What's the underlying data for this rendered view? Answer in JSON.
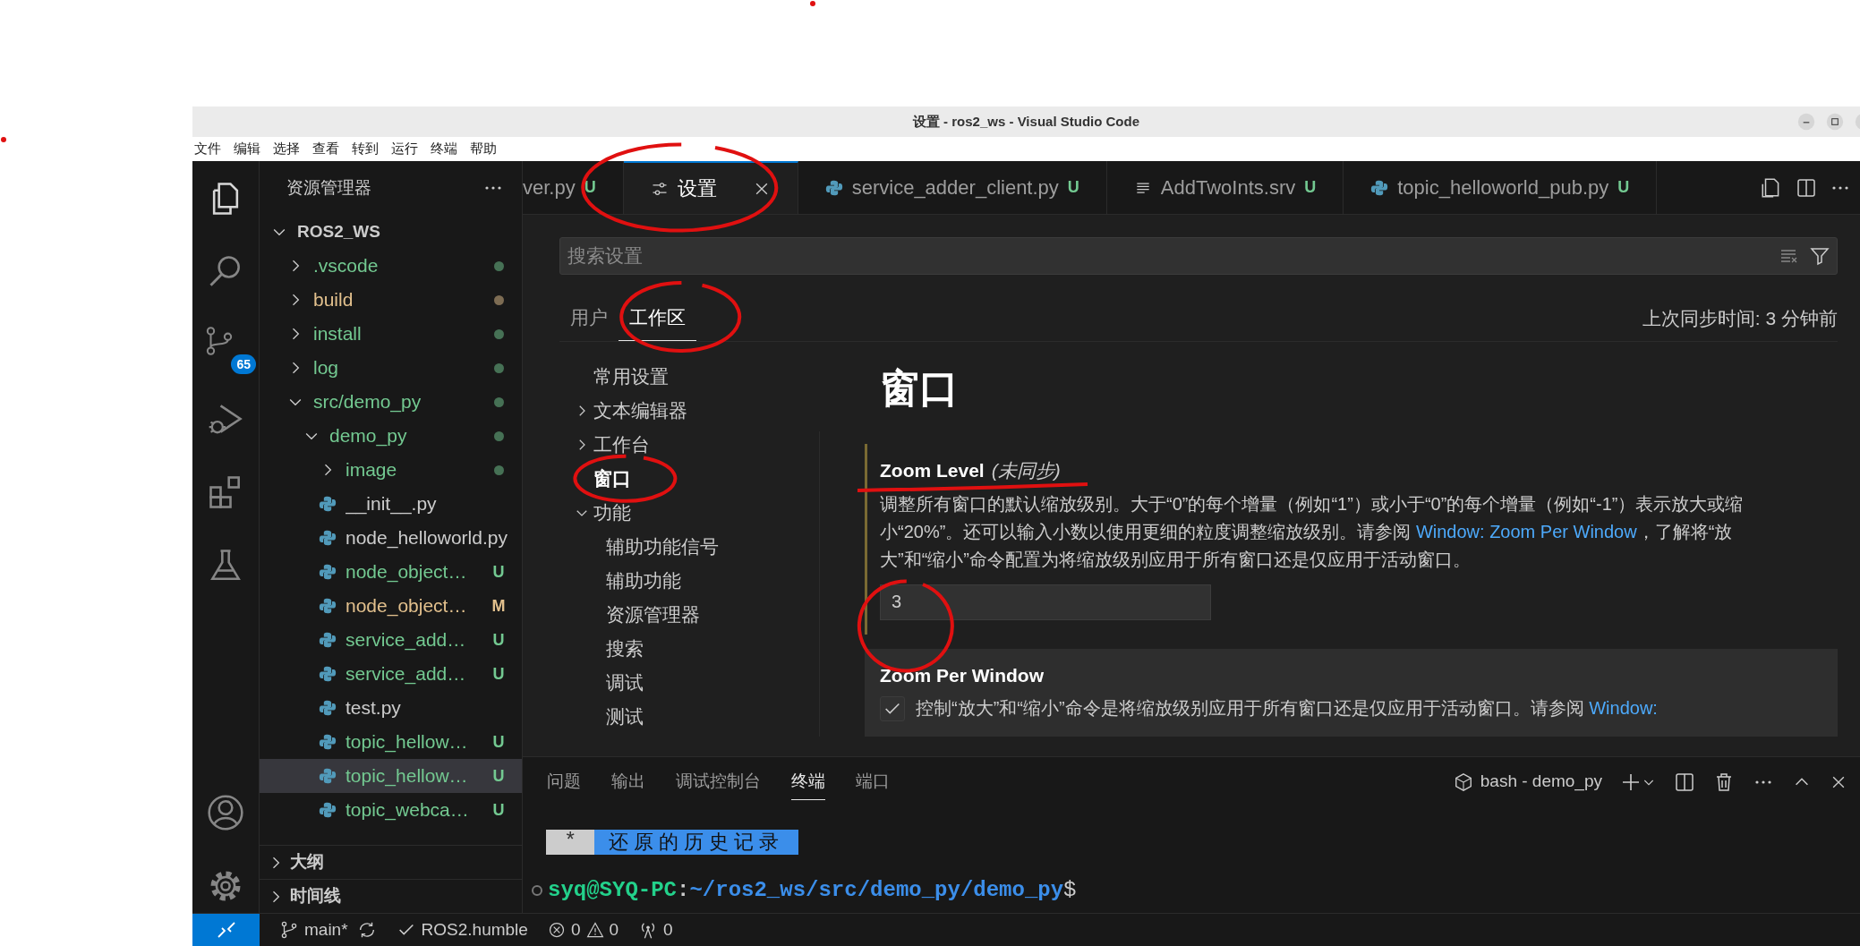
{
  "window": {
    "title": "设置 - ros2_ws - Visual Studio Code"
  },
  "menu": [
    "文件",
    "编辑",
    "选择",
    "查看",
    "转到",
    "运行",
    "终端",
    "帮助"
  ],
  "activity_bar": [
    {
      "kind": "explorer",
      "selected": true
    },
    {
      "kind": "search",
      "selected": false
    },
    {
      "kind": "source-control",
      "selected": false,
      "badge": "65"
    },
    {
      "kind": "run-debug",
      "selected": false
    },
    {
      "kind": "extensions",
      "selected": false
    },
    {
      "kind": "testing",
      "selected": false
    },
    {
      "kind": "account",
      "selected": false
    },
    {
      "kind": "manage",
      "selected": false
    }
  ],
  "sidebar": {
    "title": "资源管理器",
    "tree": {
      "label": "ROS2_WS",
      "kind": "root",
      "expanded": true,
      "selected": false,
      "children": [
        {
          "label": ".vscode",
          "kind": "folder",
          "expanded": false,
          "selected": false,
          "color": "#73c991"
        },
        {
          "label": "build",
          "kind": "folder",
          "expanded": false,
          "selected": false,
          "color": "#e2c08d"
        },
        {
          "label": "install",
          "kind": "folder",
          "expanded": false,
          "selected": false,
          "color": "#73c991"
        },
        {
          "label": "log",
          "kind": "folder",
          "expanded": false,
          "selected": false,
          "color": "#73c991"
        },
        {
          "label": "src/demo_py",
          "kind": "folder",
          "expanded": true,
          "selected": false,
          "color": "#73c991",
          "children": [
            {
              "label": "demo_py",
              "kind": "folder",
              "expanded": true,
              "selected": false,
              "color": "#73c991",
              "children": [
                {
                  "label": "image",
                  "kind": "folder",
                  "expanded": false,
                  "selected": false,
                  "color": "#73c991"
                },
                {
                  "label": "__init__.py",
                  "kind": "file",
                  "selected": false,
                  "color": "#cccccc"
                },
                {
                  "label": "node_helloworld.py",
                  "kind": "file",
                  "selected": false,
                  "color": "#cccccc"
                },
                {
                  "label": "node_object…",
                  "kind": "file",
                  "selected": false,
                  "color": "#73c991",
                  "badge": "U"
                },
                {
                  "label": "node_object…",
                  "kind": "file",
                  "selected": false,
                  "color": "#e2c08d",
                  "badge": "M"
                },
                {
                  "label": "service_add…",
                  "kind": "file",
                  "selected": false,
                  "color": "#73c991",
                  "badge": "U"
                },
                {
                  "label": "service_add…",
                  "kind": "file",
                  "selected": false,
                  "color": "#73c991",
                  "badge": "U"
                },
                {
                  "label": "test.py",
                  "kind": "file",
                  "selected": false,
                  "color": "#cccccc"
                },
                {
                  "label": "topic_hellow…",
                  "kind": "file",
                  "selected": false,
                  "color": "#73c991",
                  "badge": "U"
                },
                {
                  "label": "topic_hellow…",
                  "kind": "file",
                  "selected": true,
                  "color": "#73c991",
                  "badge": "U"
                },
                {
                  "label": "topic_webca…",
                  "kind": "file",
                  "selected": false,
                  "color": "#73c991",
                  "badge": "U"
                }
              ]
            }
          ]
        }
      ]
    },
    "sections": [
      {
        "label": "大纲",
        "expanded": false
      },
      {
        "label": "时间线",
        "expanded": false
      }
    ]
  },
  "editor": {
    "tabs": [
      {
        "label": "ver.py",
        "kind": "python",
        "badge": "U",
        "selected": false
      },
      {
        "label": "设置",
        "kind": "settings",
        "selected": true
      },
      {
        "label": "service_adder_client.py",
        "kind": "python",
        "badge": "U",
        "selected": false
      },
      {
        "label": "AddTwoInts.srv",
        "kind": "text",
        "badge": "U",
        "selected": false
      },
      {
        "label": "topic_helloworld_pub.py",
        "kind": "python",
        "badge": "U",
        "selected": false
      }
    ]
  },
  "settings": {
    "search": {
      "placeholder": "搜索设置"
    },
    "scopes": [
      {
        "label": "用户",
        "selected": false
      },
      {
        "label": "工作区",
        "selected": true
      }
    ],
    "sync_status": "上次同步时间: 3 分钟前",
    "toc": [
      {
        "label": "常用设置",
        "kind": "leaf",
        "selected": false
      },
      {
        "label": "文本编辑器",
        "kind": "group",
        "expanded": false,
        "selected": false
      },
      {
        "label": "工作台",
        "kind": "group",
        "expanded": false,
        "selected": false
      },
      {
        "label": "窗口",
        "kind": "leaf",
        "selected": true
      },
      {
        "label": "功能",
        "kind": "group",
        "expanded": true,
        "selected": false,
        "children": [
          {
            "label": "辅助功能信号",
            "kind": "leaf",
            "selected": false
          },
          {
            "label": "辅助功能",
            "kind": "leaf",
            "selected": false
          },
          {
            "label": "资源管理器",
            "kind": "leaf",
            "selected": false
          },
          {
            "label": "搜索",
            "kind": "leaf",
            "selected": false
          },
          {
            "label": "调试",
            "kind": "leaf",
            "selected": false
          },
          {
            "label": "测试",
            "kind": "leaf",
            "selected": false
          }
        ]
      }
    ],
    "section_title": "窗口",
    "items": [
      {
        "kind": "number",
        "title": "Zoom Level",
        "scope_note": "(未同步)",
        "modified": true,
        "focused": false,
        "description": "调整所有窗口的默认缩放级别。大于“0”的每个增量（例如“1”）或小于“0”的每个增量（例如“-1”）表示放大或缩小“20%”。还可以输入小数以使用更细的粒度调整缩放级别。请参阅 ",
        "link": "Window: Zoom Per Window",
        "description_after": "，了解将“放大”和“缩小”命令配置为将缩放级别应用于所有窗口还是仅应用于活动窗口。",
        "value": "3"
      },
      {
        "kind": "checkbox",
        "title": "Zoom Per Window",
        "modified": false,
        "focused": true,
        "checked": true,
        "description": "控制“放大”和“缩小”命令是将缩放级别应用于所有窗口还是仅应用于活动窗口。请参阅 ",
        "link": "Window:"
      }
    ]
  },
  "panel": {
    "tabs": [
      {
        "label": "问题",
        "selected": false
      },
      {
        "label": "输出",
        "selected": false
      },
      {
        "label": "调试控制台",
        "selected": false
      },
      {
        "label": "终端",
        "selected": true
      },
      {
        "label": "端口",
        "selected": false
      }
    ],
    "terminal_name": "bash - demo_py",
    "restore_banner": {
      "marker": "*",
      "text": "还原的历史记录"
    },
    "prompt": {
      "user_host": "syq@SYQ-PC",
      "separator": ":",
      "path": "~/ros2_ws/src/demo_py/demo_py",
      "symbol": "$"
    }
  },
  "status_bar": {
    "branch": "main*",
    "profile": "ROS2.humble",
    "errors": "0",
    "warnings": "0",
    "ports": "0"
  },
  "annotations": [
    {
      "kind": "dot"
    },
    {
      "kind": "dot"
    },
    {
      "kind": "circle"
    },
    {
      "kind": "circle"
    },
    {
      "kind": "circle"
    },
    {
      "kind": "underline"
    },
    {
      "kind": "circle"
    }
  ]
}
